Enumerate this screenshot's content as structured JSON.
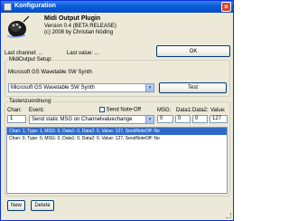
{
  "window": {
    "title": "Konfiguration",
    "close_glyph": "×"
  },
  "plugin": {
    "name": "Midi Output Plugin",
    "version": "Version 0.4 (BETA RELEASE)",
    "copyright": "(c) 2008 by Christian Nöding"
  },
  "info": {
    "last_channel": "Last channel: ...",
    "last_value": "Last value: ..."
  },
  "buttons": {
    "ok": "OK",
    "test": "Test",
    "new": "New",
    "delete": "Delete"
  },
  "midi_setup": {
    "label": "MidiOutput Setup:",
    "device_name": "Microsoft GS Wavetable SW Synth",
    "device_select": "Microsoft GS Wavetable SW Synth"
  },
  "assignment": {
    "label": "Tastenzuordnung:",
    "headers": {
      "chan": "Chan:",
      "event": "Event:",
      "send_noteoff": "Send Note-Off",
      "msg": "MSG:",
      "data1": "Data1:",
      "data2": "Data2:",
      "value": "Value:"
    },
    "fields": {
      "chan": "1",
      "event": "Send static MSG on Channelvaluechange",
      "msg": "0",
      "data1": "0",
      "data2": "0",
      "value": "127"
    },
    "list": [
      "Chan: 1, Type: 1, MSG: 0, Data1: 0, Data2: 0, Value: 127, SendNoteOff: No",
      "Chan: 0, Type: 0, MSG: 0, Data1: 0, Data2: 0, Value: 127, SendNoteOff: No"
    ]
  }
}
